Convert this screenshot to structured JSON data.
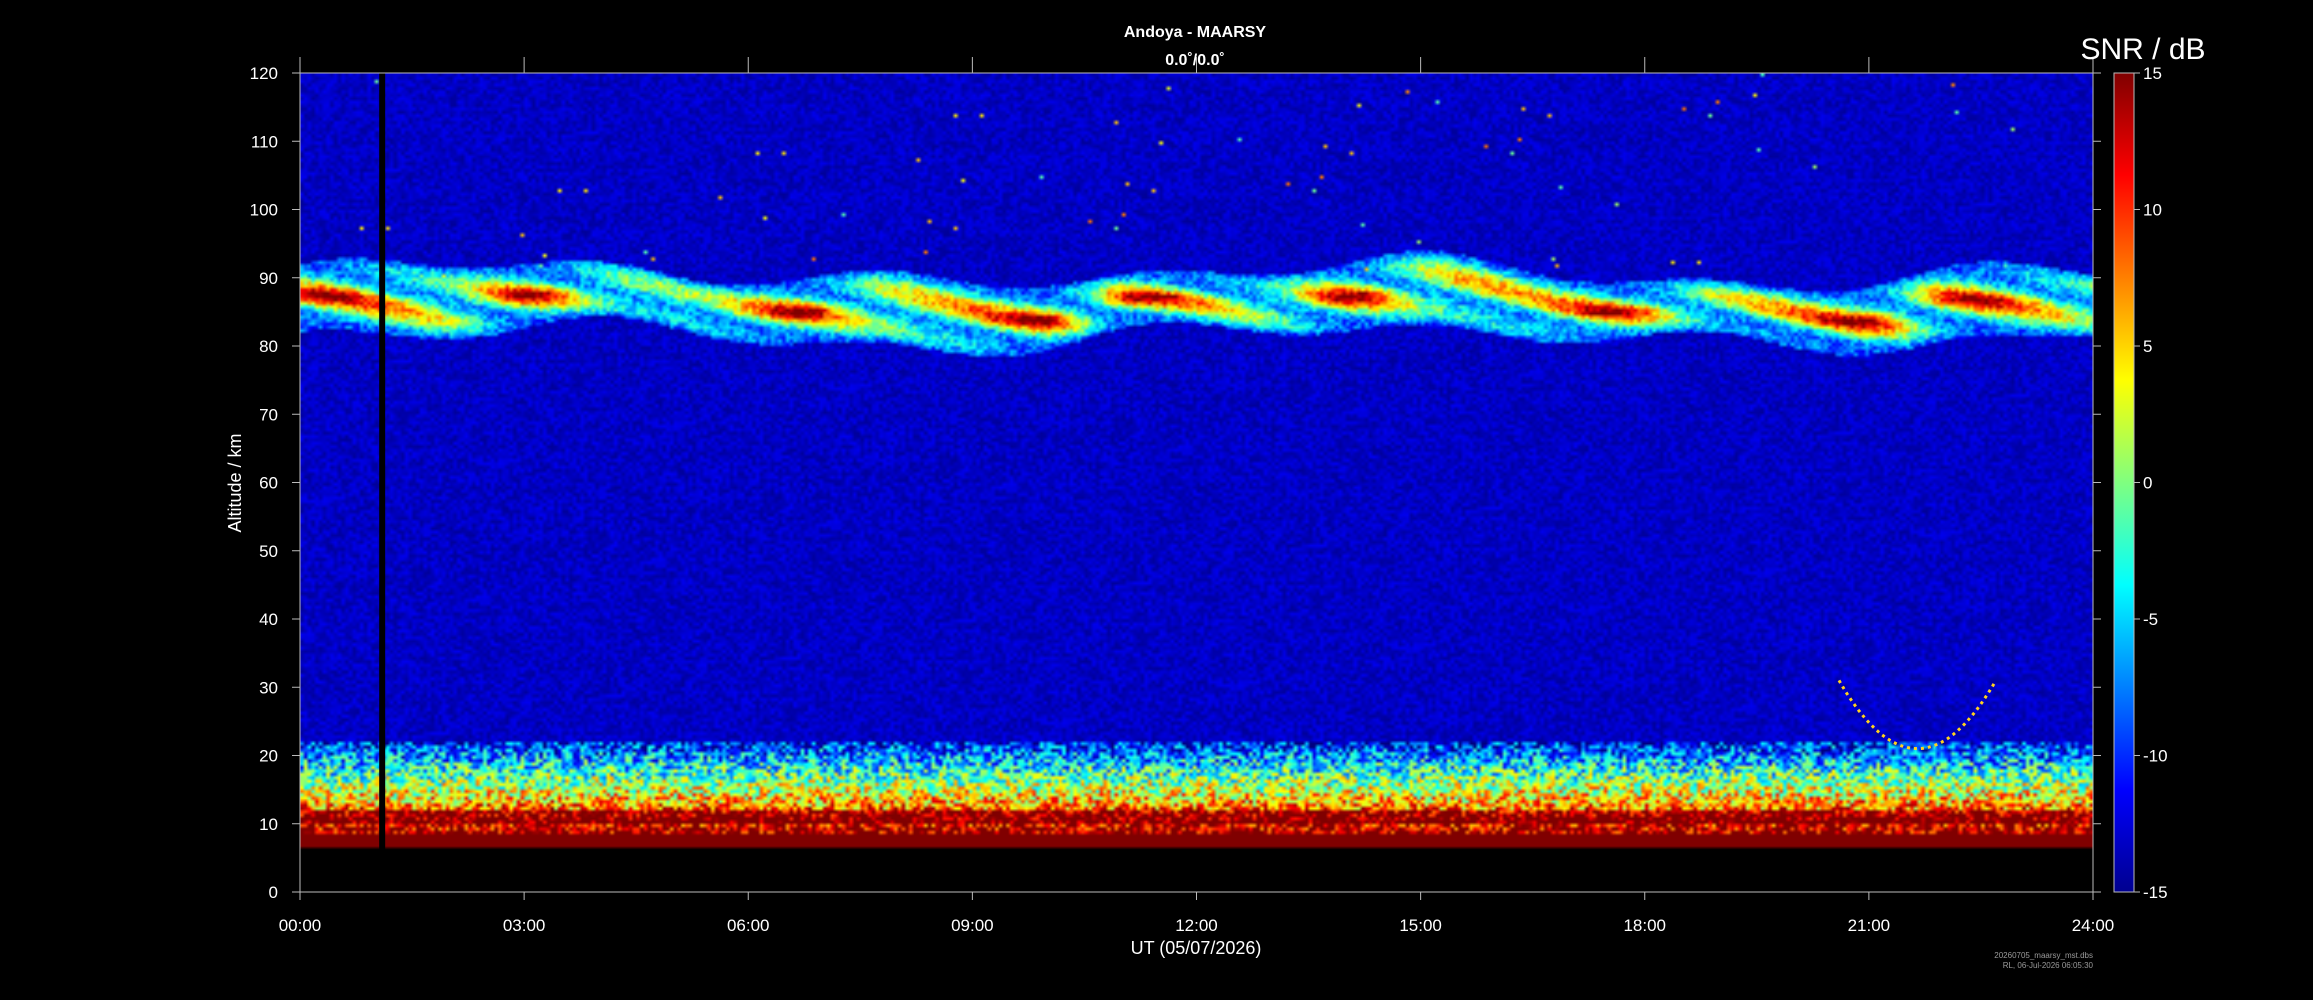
{
  "chart_data": {
    "type": "heatmap",
    "title": "Andoya - MAARSY",
    "subtitle": "0.0˚/0.0˚",
    "xlabel": "UT (05/07/2026)",
    "ylabel": "Altitude / km",
    "x_ticks": [
      "00:00",
      "03:00",
      "06:00",
      "09:00",
      "12:00",
      "15:00",
      "18:00",
      "21:00",
      "24:00"
    ],
    "xlim_hours": [
      0,
      24
    ],
    "y_ticks": [
      0,
      10,
      20,
      30,
      40,
      50,
      60,
      70,
      80,
      90,
      100,
      110,
      120
    ],
    "ylim": [
      0,
      120
    ],
    "colorbar": {
      "label": "SNR / dB",
      "range": [
        -15,
        15
      ],
      "ticks": [
        15,
        10,
        5,
        0,
        -5,
        -10,
        -15
      ],
      "colormap": "jet"
    },
    "colors": {
      "background": "#000000",
      "noise_floor": "#0a1a9e"
    },
    "features": [
      {
        "name": "PMSE layer",
        "altitude_range_km": [
          79,
          92
        ],
        "time_range_hours": [
          0,
          24
        ],
        "snr_db": 15
      },
      {
        "name": "low altitude clutter",
        "altitude_range_km": [
          7,
          22
        ],
        "time_range_hours": [
          0,
          24
        ],
        "snr_db": 15
      },
      {
        "name": "data gap",
        "time_hours": 1.1,
        "altitude_range_km": [
          6,
          120
        ]
      },
      {
        "name": "arc echo",
        "time_range_hours": [
          20.6,
          22.7
        ],
        "altitude_range_km": [
          21,
          31
        ]
      }
    ],
    "grid": false,
    "legend": "right"
  },
  "footer": {
    "line1": "20260705_maarsy_mst.dbs",
    "line2": "RL, 06-Jul-2026 06:05:30"
  }
}
